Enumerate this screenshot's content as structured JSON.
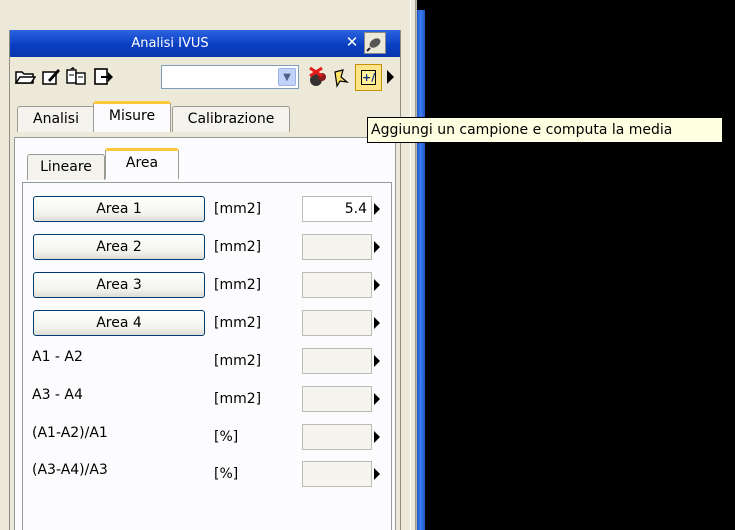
{
  "panel": {
    "title": "Analisi IVUS",
    "close_glyph": "✕",
    "pin_icon": "pin-icon"
  },
  "toolbar": {
    "icons": [
      "open-folder-icon",
      "edit-document-icon",
      "multi-edit-icon",
      "export-icon",
      "remove-marker-icon",
      "wand-icon",
      "add-sample-icon"
    ],
    "combo_value": ""
  },
  "outer_tabs": [
    {
      "label": "Analisi",
      "active": false
    },
    {
      "label": "Misure",
      "active": true
    },
    {
      "label": "Calibrazione",
      "active": false
    }
  ],
  "inner_tabs": [
    {
      "label": "Lineare",
      "active": false
    },
    {
      "label": "Area",
      "active": true
    }
  ],
  "rows": [
    {
      "label": "Area 1",
      "button": true,
      "unit": "[mm2]",
      "value": "5.4"
    },
    {
      "label": "Area 2",
      "button": true,
      "unit": "[mm2]",
      "value": ""
    },
    {
      "label": "Area 3",
      "button": true,
      "unit": "[mm2]",
      "value": ""
    },
    {
      "label": "Area 4",
      "button": true,
      "unit": "[mm2]",
      "value": ""
    },
    {
      "label": "A1 - A2",
      "button": false,
      "unit": "[mm2]",
      "value": ""
    },
    {
      "label": "A3 - A4",
      "button": false,
      "unit": "[mm2]",
      "value": ""
    },
    {
      "label": "(A1-A2)/A1",
      "button": false,
      "unit": "[%]",
      "value": ""
    },
    {
      "label": "(A3-A4)/A3",
      "button": false,
      "unit": "[%]",
      "value": ""
    }
  ],
  "tooltip": {
    "text": "Aggiungi un campione e computa la media"
  },
  "colors": {
    "title_bar": "#0a3fc2",
    "active_tab_accent": "#ffc83c",
    "viewer_bg": "#000000",
    "tooltip_bg": "#ffffe1"
  }
}
